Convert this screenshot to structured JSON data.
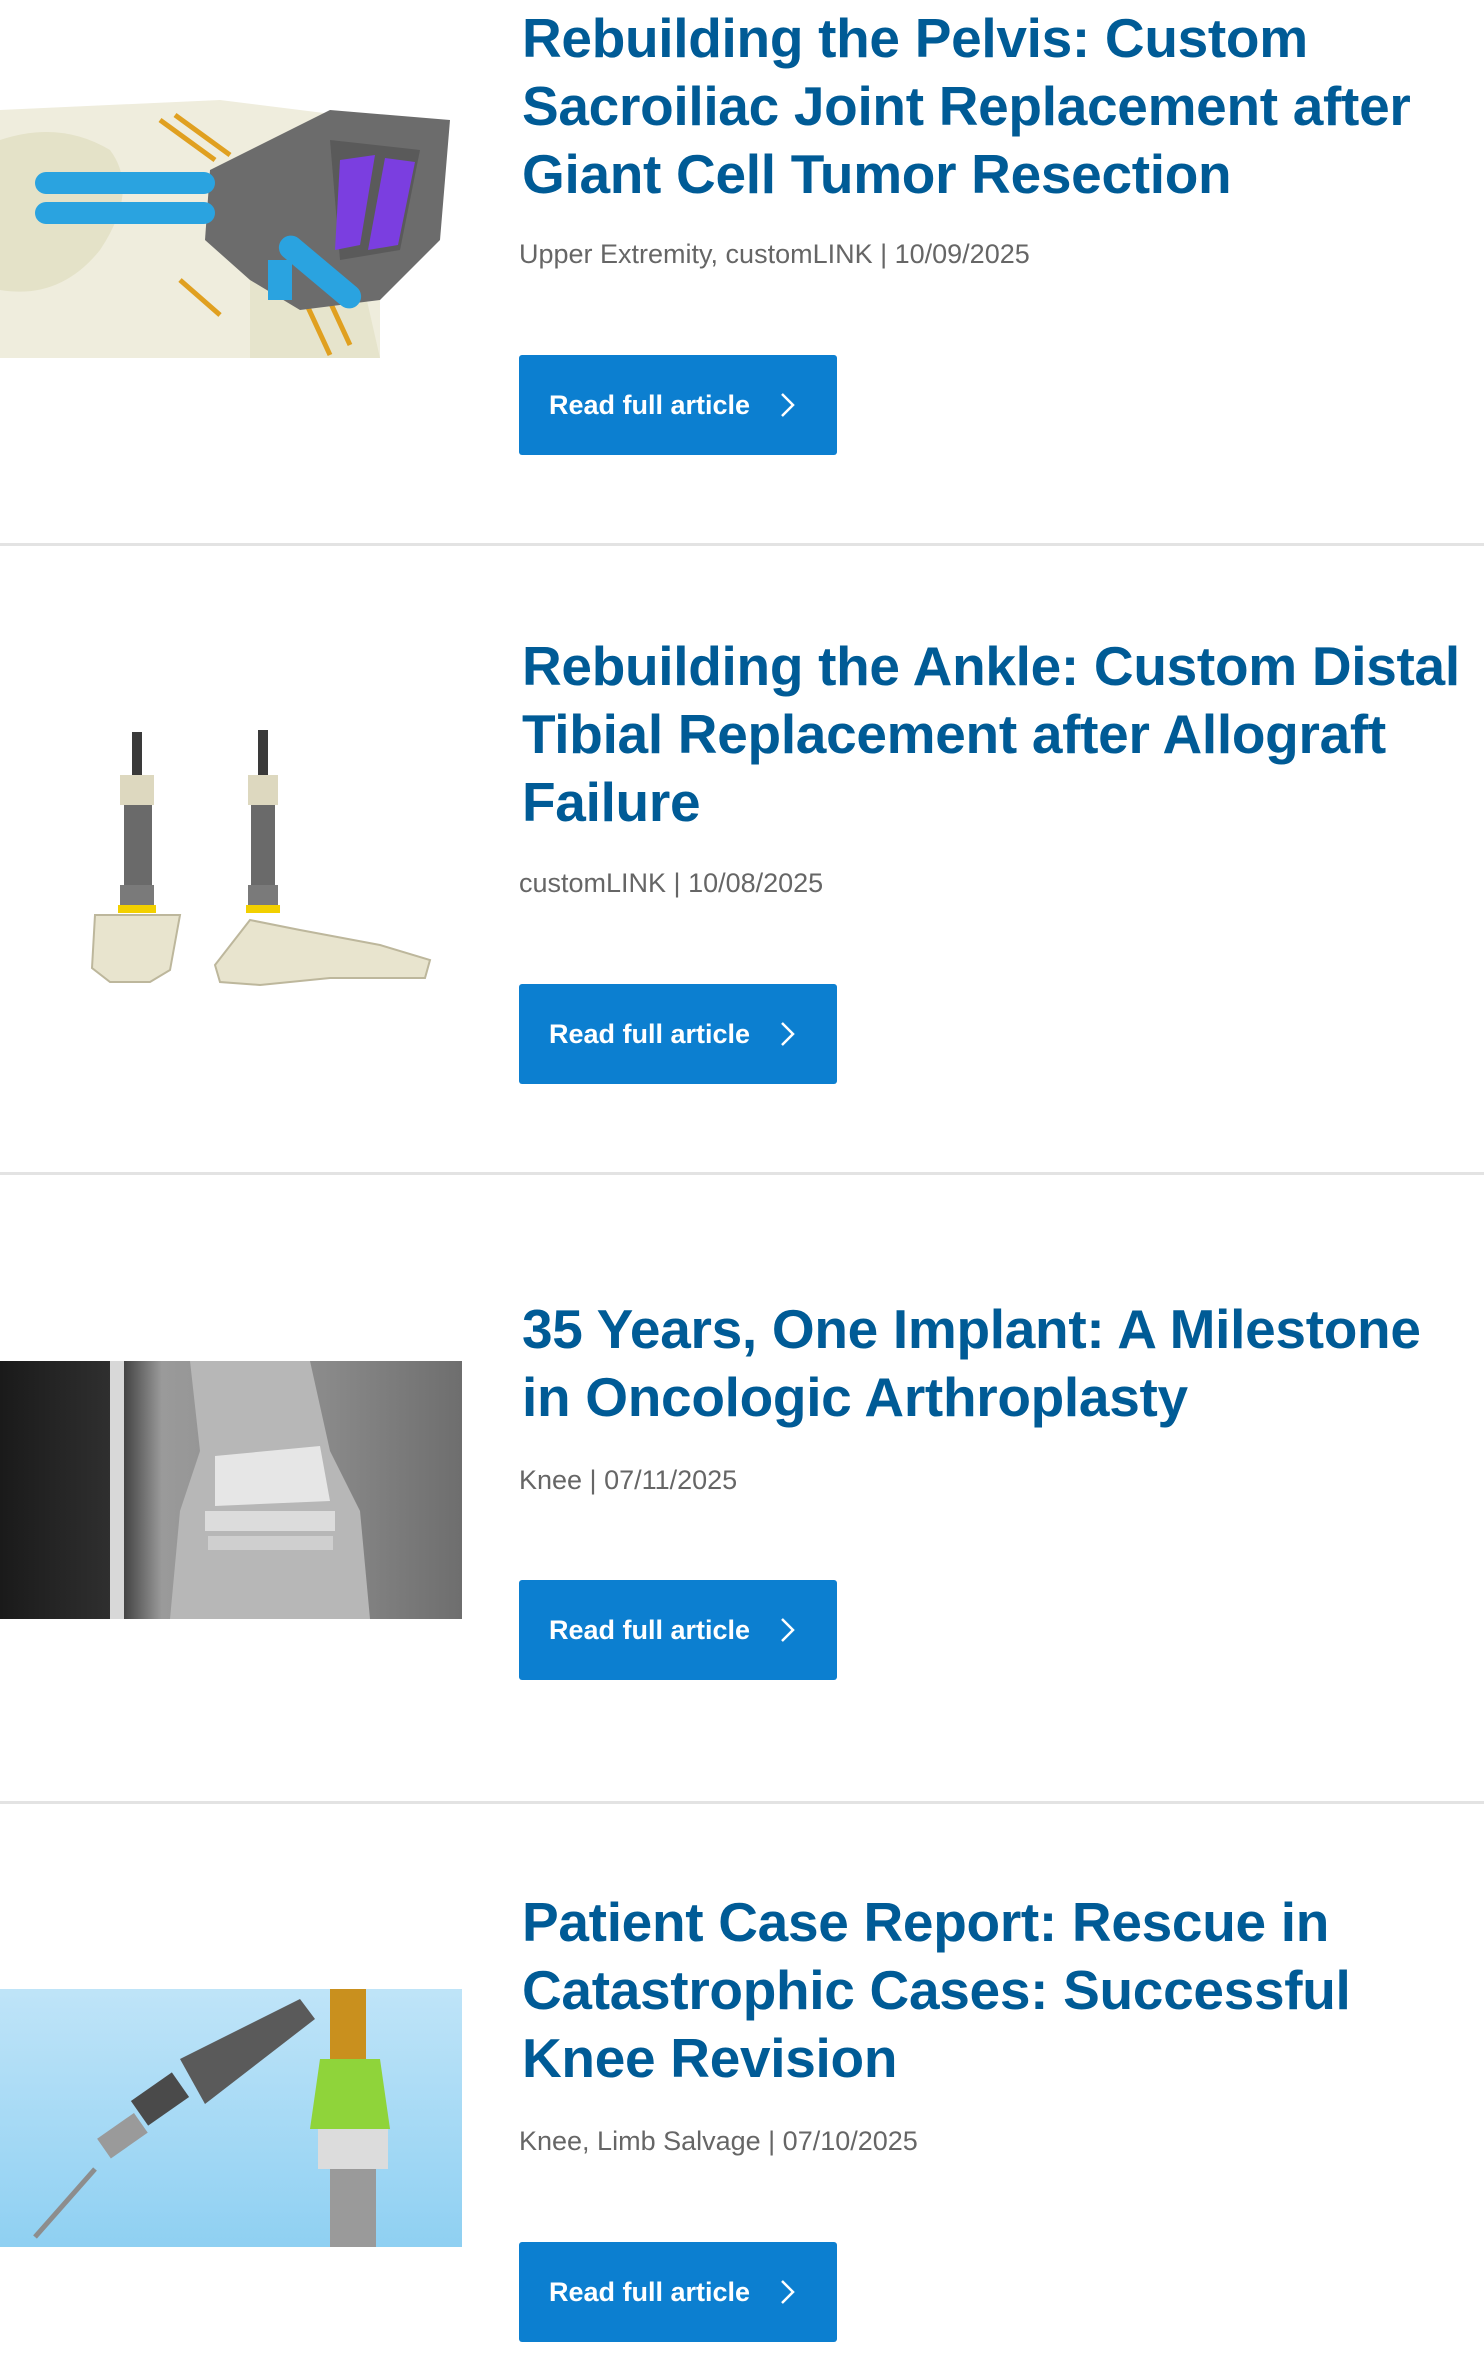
{
  "articles": [
    {
      "title": "Rebuilding the Pelvis: Custom Sacroiliac Joint Replacement after Giant Cell Tumor Resection",
      "meta": "Upper Extremity, customLINK | 10/09/2025",
      "button_label": "Read full article",
      "image": "pelvis-implant-render"
    },
    {
      "title": "Rebuilding the Ankle: Custom Distal Tibial Replacement after Allograft Failure",
      "meta": "customLINK | 10/08/2025",
      "button_label": "Read full article",
      "image": "ankle-implant-render"
    },
    {
      "title": "35 Years, One Implant: A Milestone in Oncologic Arthroplasty",
      "meta": "Knee | 07/11/2025",
      "button_label": "Read full article",
      "image": "knee-xray"
    },
    {
      "title": "Patient Case Report: Rescue in Catastrophic Cases: Successful Knee Revision",
      "meta": "Knee, Limb Salvage | 07/10/2025",
      "button_label": "Read full article",
      "image": "knee-revision-render"
    }
  ],
  "colors": {
    "title": "#005b96",
    "button": "#0c7fd0",
    "meta": "#666666",
    "divider": "#e3e3e3"
  },
  "icons": {
    "button": "chevron-right-icon"
  }
}
